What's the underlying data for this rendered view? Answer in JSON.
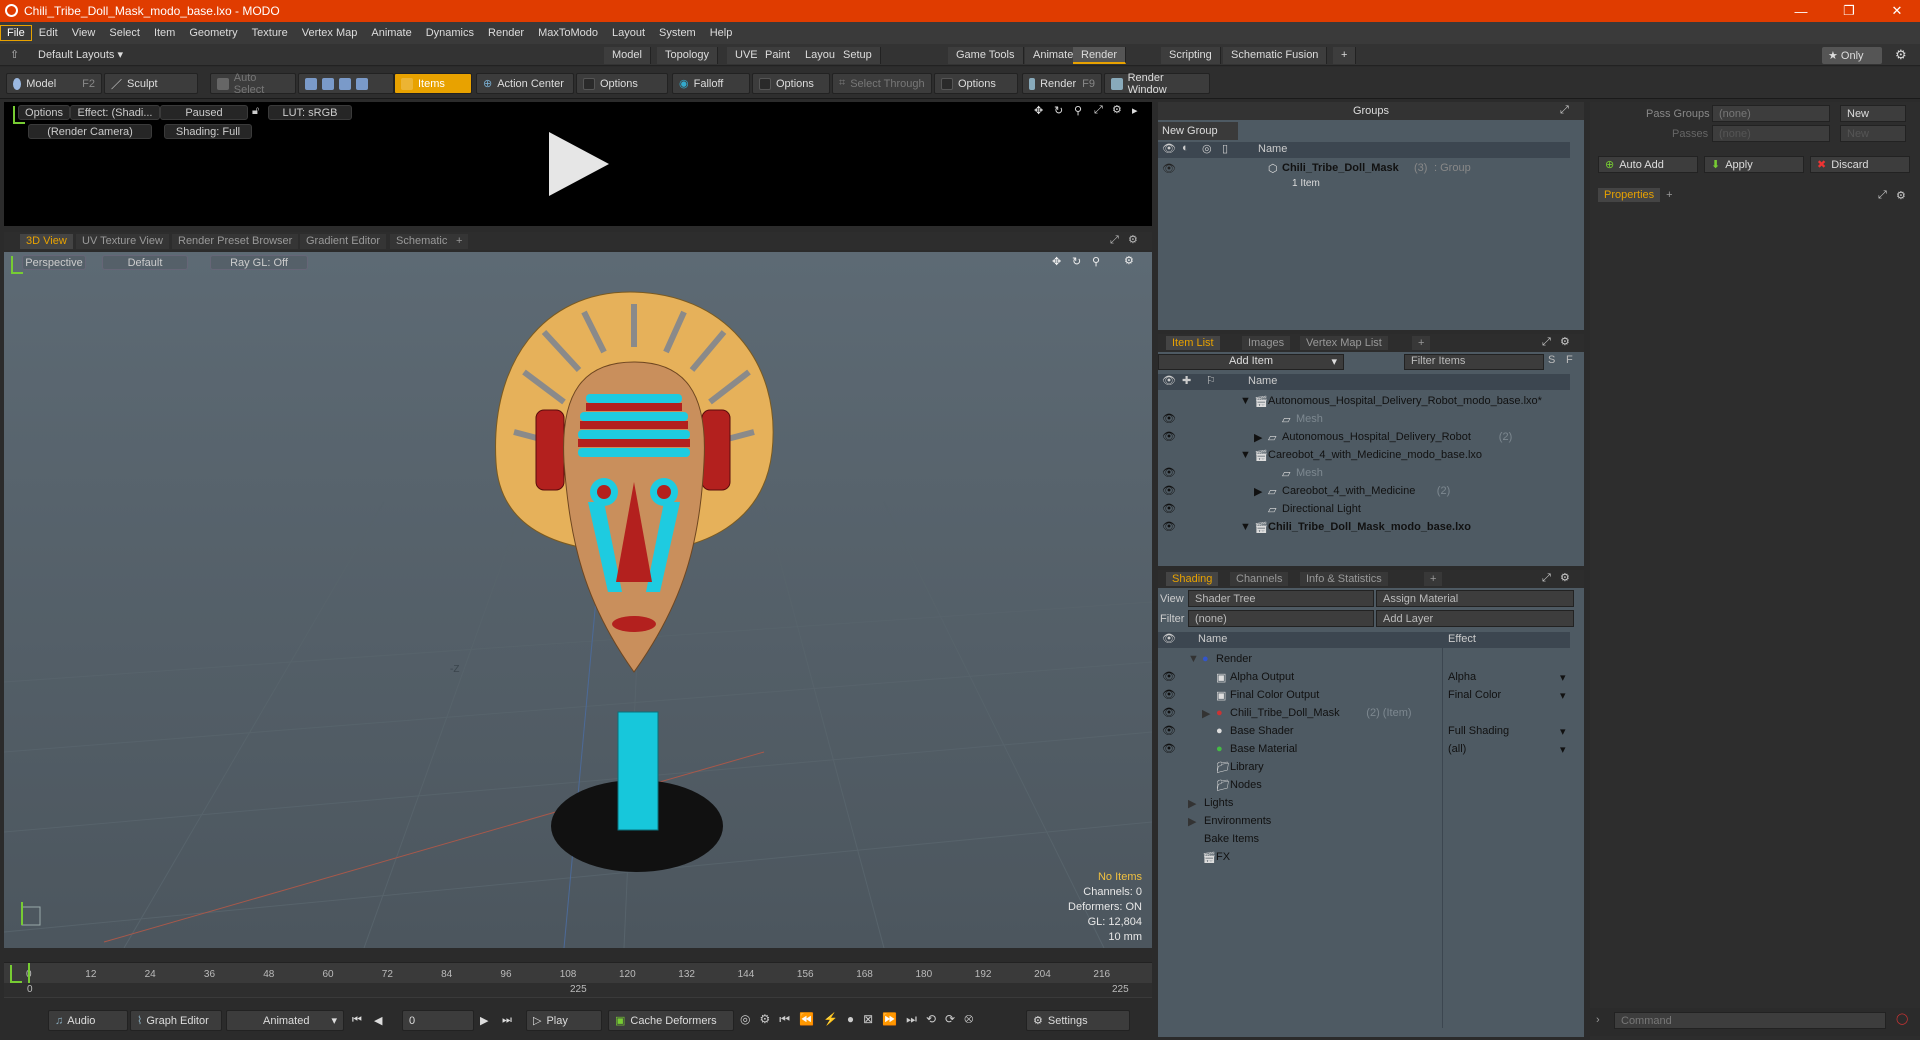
{
  "window": {
    "title": "Chili_Tribe_Doll_Mask_modo_base.lxo - MODO",
    "min": "—",
    "max": "❐",
    "close": "✕"
  },
  "menu": [
    "File",
    "Edit",
    "View",
    "Select",
    "Item",
    "Geometry",
    "Texture",
    "Vertex Map",
    "Animate",
    "Dynamics",
    "Render",
    "MaxToModo",
    "Layout",
    "System",
    "Help"
  ],
  "layouts": {
    "default": "Default Layouts ▾",
    "tabs": [
      "Model",
      "Topology",
      "UVEdit",
      "Paint",
      "Layout",
      "Setup",
      "Game Tools",
      "Animate",
      "Render",
      "Scripting",
      "Schematic Fusion",
      "+"
    ],
    "active": "Render",
    "only": "★  Only"
  },
  "toolbar": {
    "model": "Model",
    "model_key": "F2",
    "sculpt": "Sculpt",
    "auto_select": "Auto Select",
    "items": "Items",
    "action_center": "Action Center",
    "options1": "Options",
    "falloff": "Falloff",
    "options2": "Options",
    "select_through": "Select Through",
    "options3": "Options",
    "render": "Render",
    "render_key": "F9",
    "render_window": "Render Window"
  },
  "render_view": {
    "options": "Options",
    "effect": "Effect: (Shadi...",
    "paused": "Paused",
    "lut": "LUT: sRGB",
    "camera": "(Render Camera)",
    "shading": "Shading: Full"
  },
  "view_tabs": [
    "3D View",
    "UV Texture View",
    "Render Preset Browser",
    "Gradient Editor",
    "Schematic",
    "+"
  ],
  "viewport": {
    "perspective": "Perspective",
    "default": "Default",
    "raygl": "Ray GL: Off",
    "axis_label": "-Z",
    "stats": [
      "No Items",
      "Channels: 0",
      "Deformers: ON",
      "GL: 12,804",
      "10 mm"
    ]
  },
  "timeline": {
    "ticks": [
      "0",
      "12",
      "24",
      "36",
      "48",
      "60",
      "72",
      "84",
      "96",
      "108",
      "120",
      "132",
      "144",
      "156",
      "168",
      "180",
      "192",
      "204",
      "216"
    ],
    "sub": [
      "0",
      "225",
      "225"
    ]
  },
  "bottom": {
    "audio": "Audio",
    "graph_editor": "Graph Editor",
    "animated": "Animated",
    "frame": "0",
    "play": "Play",
    "cache": "Cache Deformers",
    "settings": "Settings"
  },
  "groups": {
    "header": "Groups",
    "new_group": "New Group",
    "col_name": "Name",
    "item_name": "Chili_Tribe_Doll_Mask",
    "item_count": "(3)",
    "item_type": ": Group",
    "item_sub": "1 Item"
  },
  "item_list": {
    "tabs": [
      "Item List",
      "Images",
      "Vertex Map List",
      "+"
    ],
    "add_item": "Add Item",
    "filter": "Filter Items",
    "col_name": "Name",
    "rows": [
      {
        "label": "Autonomous_Hospital_Delivery_Robot_modo_base.lxo*",
        "indent": 0,
        "bold": false,
        "dim": false,
        "eye": false
      },
      {
        "label": "Mesh",
        "indent": 2,
        "bold": false,
        "dim": true,
        "eye": true
      },
      {
        "label": "Autonomous_Hospital_Delivery_Robot",
        "extra": "(2)",
        "indent": 1,
        "bold": false,
        "dim": false,
        "eye": true
      },
      {
        "label": "Careobot_4_with_Medicine_modo_base.lxo",
        "indent": 0,
        "bold": false,
        "dim": false,
        "eye": false
      },
      {
        "label": "Mesh",
        "indent": 2,
        "bold": false,
        "dim": true,
        "eye": true
      },
      {
        "label": "Careobot_4_with_Medicine",
        "extra": "(2)",
        "indent": 1,
        "bold": false,
        "dim": false,
        "eye": true
      },
      {
        "label": "Directional Light",
        "indent": 1,
        "bold": false,
        "dim": false,
        "eye": true
      },
      {
        "label": "Chili_Tribe_Doll_Mask_modo_base.lxo",
        "indent": 0,
        "bold": true,
        "dim": false,
        "eye": true
      }
    ]
  },
  "shading": {
    "tabs": [
      "Shading",
      "Channels",
      "Info & Statistics",
      "+"
    ],
    "view_label": "View",
    "view_value": "Shader Tree",
    "assign": "Assign Material",
    "filter_label": "Filter",
    "filter_value": "(none)",
    "add_layer": "Add Layer",
    "col_name": "Name",
    "col_effect": "Effect",
    "rows": [
      {
        "label": "Render",
        "effect": "",
        "indent": 0
      },
      {
        "label": "Alpha Output",
        "effect": "Alpha",
        "indent": 1
      },
      {
        "label": "Final Color Output",
        "effect": "Final Color",
        "indent": 1
      },
      {
        "label": "Chili_Tribe_Doll_Mask",
        "extra": "(2) (Item)",
        "effect": "",
        "indent": 1
      },
      {
        "label": "Base Shader",
        "effect": "Full Shading",
        "indent": 1
      },
      {
        "label": "Base Material",
        "effect": "(all)",
        "indent": 1
      },
      {
        "label": "Library",
        "effect": "",
        "indent": 1
      },
      {
        "label": "Nodes",
        "effect": "",
        "indent": 1
      },
      {
        "label": "Lights",
        "effect": "",
        "indent": 0
      },
      {
        "label": "Environments",
        "effect": "",
        "indent": 0
      },
      {
        "label": "Bake Items",
        "effect": "",
        "indent": 0
      },
      {
        "label": "FX",
        "effect": "",
        "indent": 0
      }
    ]
  },
  "right": {
    "pass_groups": "Pass Groups",
    "passes": "Passes",
    "none": "(none)",
    "new": "New",
    "auto_add": "Auto Add",
    "apply": "Apply",
    "discard": "Discard",
    "properties": "Properties",
    "command": "Command"
  }
}
